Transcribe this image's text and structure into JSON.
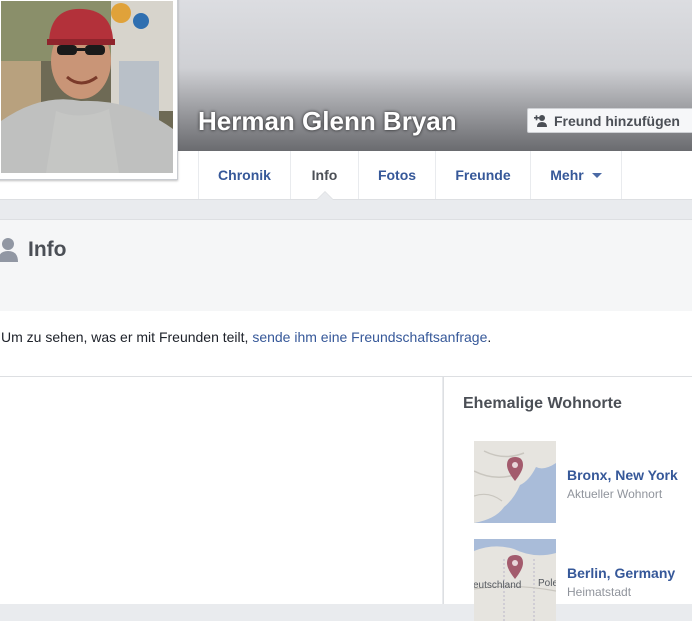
{
  "profile": {
    "name": "Herman Glenn Bryan",
    "add_friend_label": "Freund hinzufügen"
  },
  "nav": {
    "tabs": [
      {
        "label": "Chronik"
      },
      {
        "label": "Info"
      },
      {
        "label": "Fotos"
      },
      {
        "label": "Freunde"
      },
      {
        "label": "Mehr"
      }
    ],
    "active_tab": "Info"
  },
  "info": {
    "title": "Info",
    "notice_prefix": "Um zu sehen, was er mit Freunden teilt, ",
    "notice_link": "sende ihm eine Freundschaftsanfrage",
    "notice_suffix": "."
  },
  "places": {
    "title": "Ehemalige Wohnorte",
    "items": [
      {
        "name": "Bronx, New York",
        "sub": "Aktueller Wohnort",
        "map_icon": "map-pin-icon"
      },
      {
        "name": "Berlin, Germany",
        "sub": "Heimatstadt",
        "map_icon": "map-pin-icon",
        "map_labels": [
          "eutschland",
          "Pole"
        ]
      }
    ]
  },
  "colors": {
    "link": "#365899",
    "muted": "#90949c",
    "heading": "#4b4f56"
  }
}
